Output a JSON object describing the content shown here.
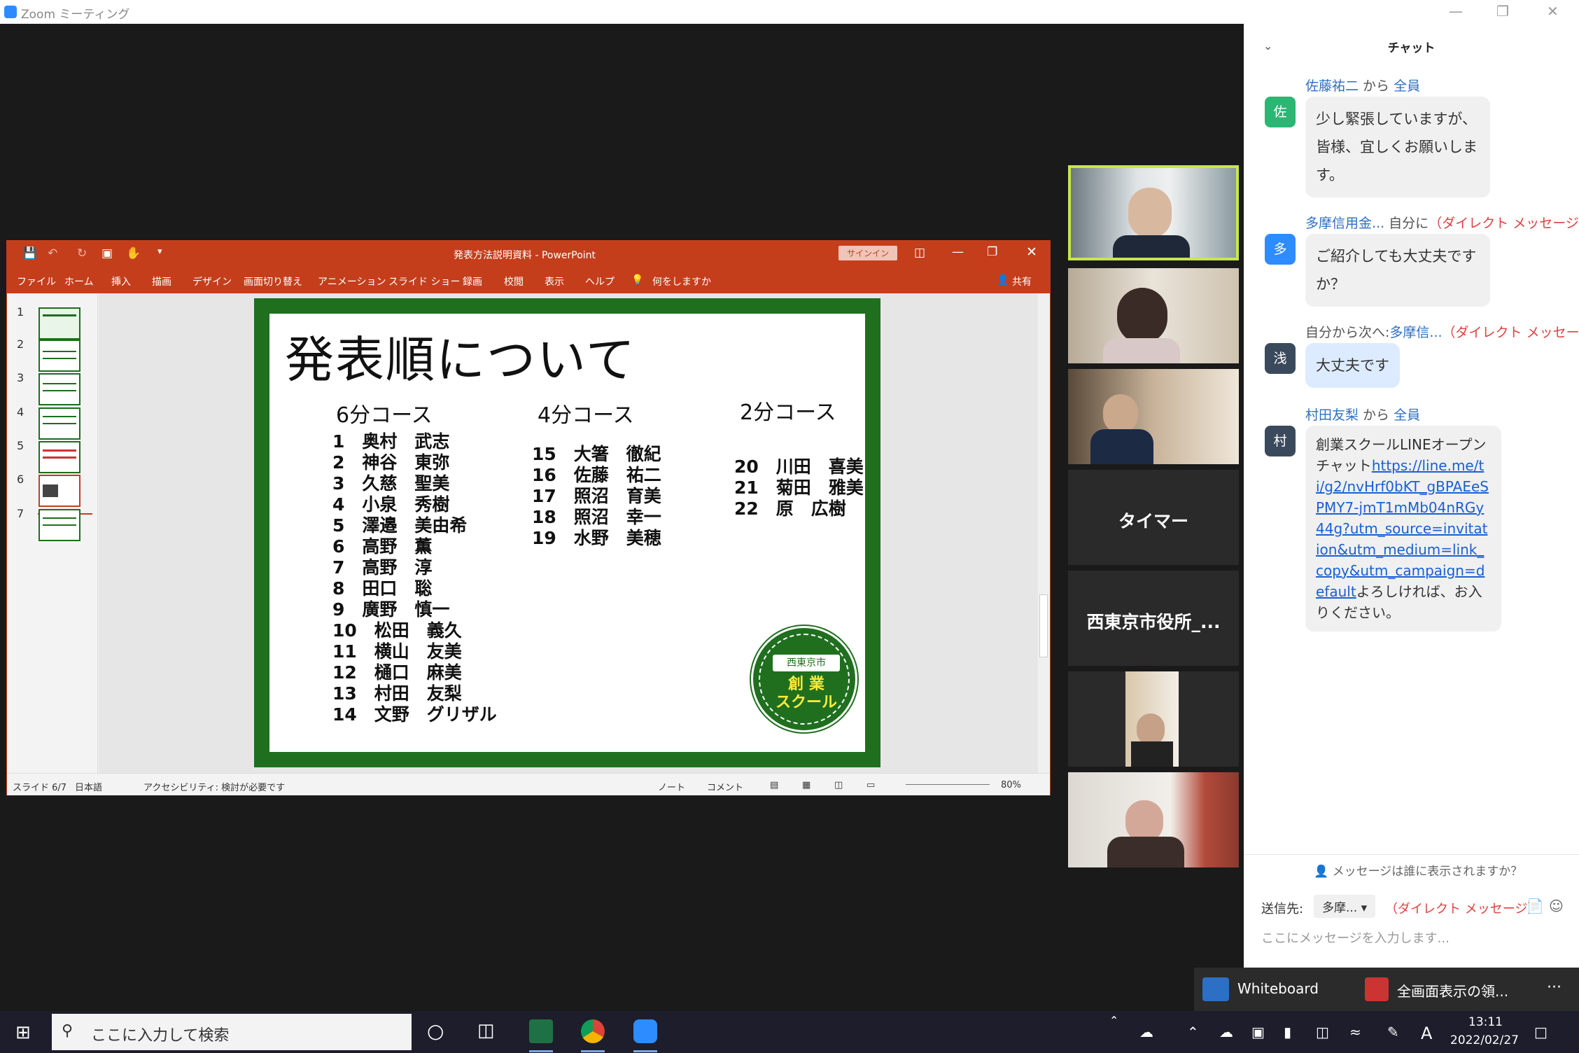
{
  "zoom": {
    "window_title": "Zoom ミーティング",
    "controls": {
      "minimize": "—",
      "restore": "❐",
      "close": "✕"
    }
  },
  "ppt": {
    "title": "発表方法説明資料 - PowerPoint",
    "signin": "サインイン",
    "menu": [
      "ファイル",
      "ホーム",
      "挿入",
      "描画",
      "デザイン",
      "画面切り替え",
      "アニメーション",
      "スライド ショー",
      "録画",
      "校閲",
      "表示",
      "ヘルプ"
    ],
    "tell_me": "何をしますか",
    "share": "共有",
    "thumb_numbers": [
      "1",
      "2",
      "3",
      "4",
      "5",
      "6",
      "7"
    ],
    "status": {
      "slide": "スライド 6/7",
      "language": "日本語",
      "accessibility": "アクセシビリティ: 検討が必要です",
      "notes": "ノート",
      "comments": "コメント",
      "zoom": "80%"
    },
    "slide": {
      "title": "発表順について",
      "course6": {
        "heading": "6分コース",
        "entries": [
          "1　奥村　武志",
          "2　神谷　東弥",
          "3　久慈　聖美",
          "4　小泉　秀樹",
          "5　澤邉　美由希",
          "6　高野　薫",
          "7　高野　淳",
          "8　田口　聡",
          "9　廣野　慎一",
          "10　松田　義久",
          "11　横山　友美",
          "12　樋口　麻美",
          "13　村田　友梨",
          "14　文野　グリザル"
        ]
      },
      "course4": {
        "heading": "4分コース",
        "entries": [
          "15　大箸　徹紀",
          "16　佐藤　祐二",
          "17　照沼　育美",
          "18　照沼　幸一",
          "19　水野　美穂"
        ]
      },
      "course2": {
        "heading": "2分コース",
        "entries": [
          "20　川田　喜美",
          "21　菊田　雅美",
          "22　原　広樹"
        ]
      },
      "seal": {
        "city": "西東京市",
        "school_line1": "創 業",
        "school_line2": "スクール"
      }
    }
  },
  "tiles": {
    "timer": "タイマー",
    "city_hall": "西東京市役所_..."
  },
  "chat": {
    "header": "チャット",
    "messages": [
      {
        "avatar": "佐",
        "from": "佐藤祐二",
        "mid": " から ",
        "to": "全員",
        "dm": "",
        "text": "少し緊張していますが、皆様、宜しくお願いします。"
      },
      {
        "avatar": "多",
        "from": "多摩信用金... ",
        "mid": "自分に",
        "to": "",
        "dm": "（ダイレクト メッセージ）",
        "text": "ご紹介しても大丈夫ですか？"
      },
      {
        "avatar": "浅",
        "from": "",
        "mid": "自分から次へ:",
        "to": "多摩信...",
        "dm": "（ダイレクト メッセージ）",
        "text": "大丈夫です"
      },
      {
        "avatar": "村",
        "from": "村田友梨",
        "mid": " から ",
        "to": "全員",
        "dm": "",
        "text_before": "創業スクールLINEオープンチャット",
        "link": "https://line.me/ti/g2/nvHrf0bKT_gBPAEeSPMY7-jmT1mMb04nRGy44g?utm_source=invitation&utm_medium=link_copy&utm_campaign=default",
        "text_after": "よろしければ、お入りください。"
      }
    ],
    "visibility_note": "メッセージは誰に表示されますか？",
    "send_to_label": "送信先:",
    "send_to_value": "多摩...",
    "send_to_dm": "（ダイレクト メッセージ）",
    "input_placeholder": "ここにメッセージを入力します..."
  },
  "floatbar": {
    "whiteboard": "Whiteboard",
    "fullscreen": "全画面表示の領...",
    "more": "···"
  },
  "taskbar": {
    "search_placeholder": "ここに入力して検索",
    "ime": "A",
    "time": "13:11",
    "date": "2022/02/27"
  },
  "colors": {
    "ppt_red": "#c43e1c",
    "slide_green": "#1f6f1f",
    "zoom_blue": "#2d8cff",
    "link_blue": "#1a5fd6",
    "dm_red": "#e04040"
  }
}
